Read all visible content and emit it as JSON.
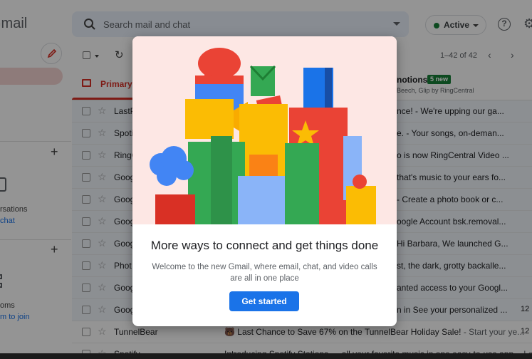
{
  "header": {
    "logo": "Gmail",
    "search_placeholder": "Search mail and chat",
    "status": "Active"
  },
  "sidebar": {
    "conversations_label": "rsations",
    "chat_link": "chat",
    "rooms_label": "oms",
    "join_link": "m to join"
  },
  "toolbar": {
    "range": "1–42 of 42"
  },
  "tabs": {
    "primary": "Primary",
    "promotions": "notions",
    "promotions_badge": "5 new",
    "promotions_sub": "Beech, Glip by RingCentral"
  },
  "rows": [
    {
      "sender": "LastP",
      "snippet": "nce! - We're upping our ga...",
      "date": ""
    },
    {
      "sender": "Spoti",
      "snippet": "e. - Your songs, on-deman...",
      "date": ""
    },
    {
      "sender": "RingC",
      "snippet": "o is now RingCentral Video ...",
      "date": ""
    },
    {
      "sender": "Goog",
      "snippet": "that's music to your ears fo...",
      "date": ""
    },
    {
      "sender": "Goog",
      "snippet": "- Create a photo book or c...",
      "date": ""
    },
    {
      "sender": "Goog",
      "snippet": "oogle Account bsk.removal...",
      "date": ""
    },
    {
      "sender": "Goog",
      "snippet": "Hi Barbara, We launched G...",
      "date": ""
    },
    {
      "sender": "Phot",
      "snippet": "st, the dark, grotty backalle...",
      "date": ""
    },
    {
      "sender": "Goog",
      "snippet": "anted access to your Googl...",
      "date": ""
    },
    {
      "sender": "Goog",
      "snippet": "n in See your personalized ...",
      "date": "12"
    }
  ],
  "full_rows": [
    {
      "sender": "TunnelBear",
      "subject": "🐻 Last Chance to Save 67% on the TunnelBear Holiday Sale!",
      "snippet": " - Start your ye...",
      "date": "12"
    },
    {
      "sender": "Spotify",
      "subject": "Introducing Spotify Stations — all your favorite music in one easy-to-use app.",
      "snippet": " - Lot...",
      "date": ""
    }
  ],
  "modal": {
    "title": "More ways to connect and get things done",
    "body": "Welcome to the new Gmail, where email, chat, and video calls are all in one place",
    "button": "Get started"
  },
  "colors": {
    "gmail_red": "#d93025",
    "google_blue": "#1a73e8",
    "google_green": "#188038",
    "google_yellow": "#f9ab00",
    "hero_bg": "#fde7e4"
  }
}
